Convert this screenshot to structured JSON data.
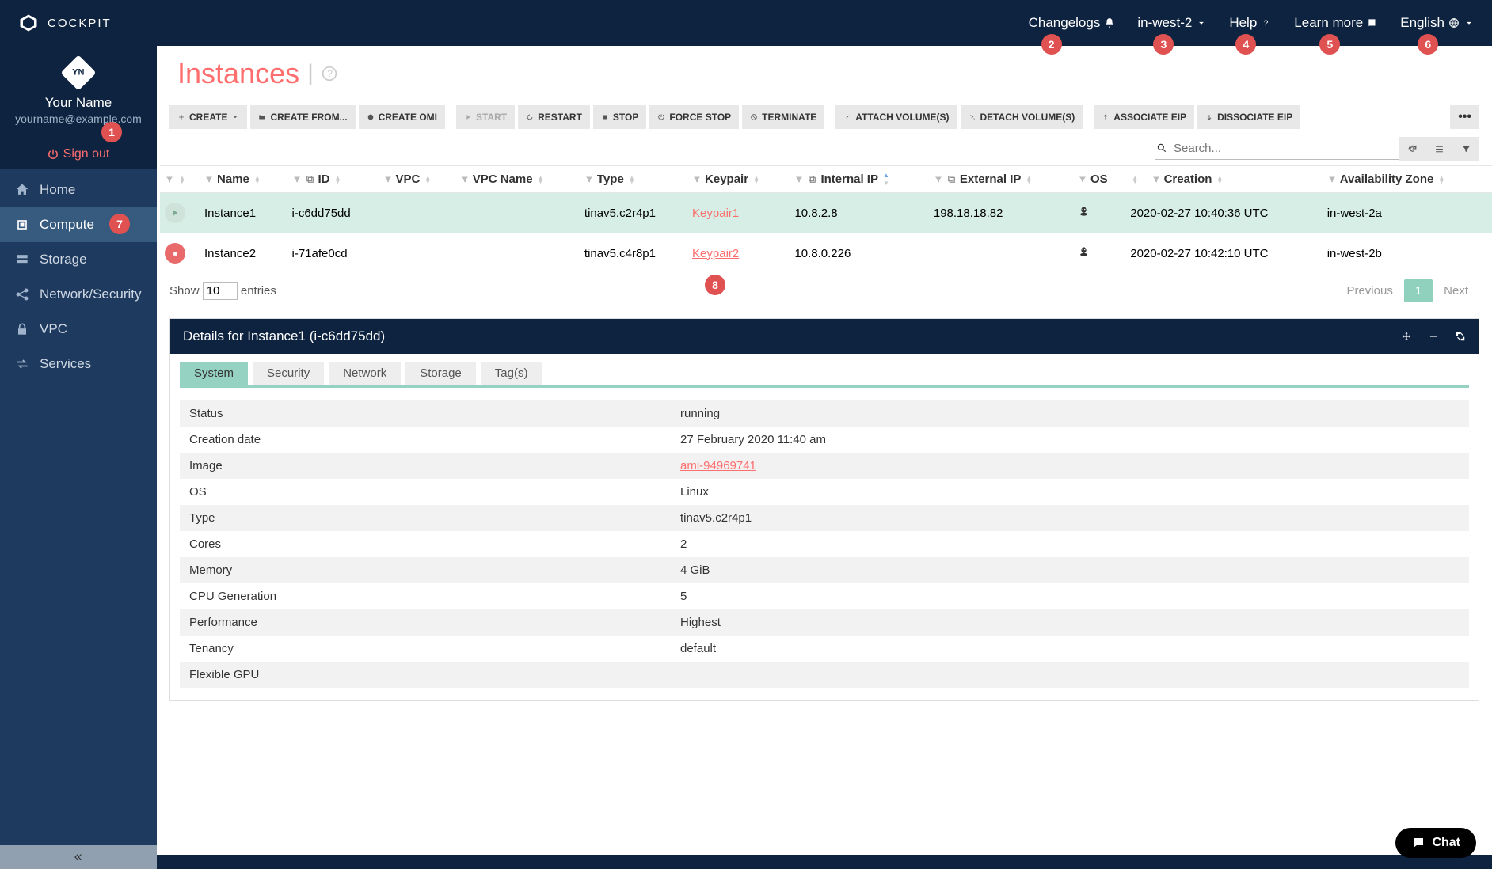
{
  "brand": "COCKPIT",
  "topnav": {
    "changelogs": "Changelogs",
    "region": "in-west-2",
    "help": "Help",
    "learnmore": "Learn more",
    "language": "English"
  },
  "callouts": {
    "c1": "1",
    "c2": "2",
    "c3": "3",
    "c4": "4",
    "c5": "5",
    "c6": "6",
    "c7": "7",
    "c8": "8"
  },
  "user": {
    "initials": "YN",
    "name": "Your Name",
    "email": "yourname@example.com",
    "signout": "Sign out"
  },
  "sidebar": {
    "items": [
      {
        "label": "Home"
      },
      {
        "label": "Compute"
      },
      {
        "label": "Storage"
      },
      {
        "label": "Network/Security"
      },
      {
        "label": "VPC"
      },
      {
        "label": "Services"
      }
    ]
  },
  "page": {
    "title": "Instances"
  },
  "toolbar": {
    "create": "CREATE",
    "createfrom": "CREATE FROM...",
    "createomi": "CREATE OMI",
    "start": "START",
    "restart": "RESTART",
    "stop": "STOP",
    "forcestop": "FORCE STOP",
    "terminate": "TERMINATE",
    "attach": "ATTACH VOLUME(S)",
    "detach": "DETACH VOLUME(S)",
    "assoc": "ASSOCIATE EIP",
    "dissoc": "DISSOCIATE EIP"
  },
  "search": {
    "placeholder": "Search..."
  },
  "columns": {
    "name": "Name",
    "id": "ID",
    "vpc": "VPC",
    "vpcname": "VPC Name",
    "type": "Type",
    "keypair": "Keypair",
    "intip": "Internal IP",
    "extip": "External IP",
    "os": "OS",
    "creation": "Creation",
    "az": "Availability Zone"
  },
  "rows": [
    {
      "state": "running",
      "name": "Instance1",
      "id": "i-c6dd75dd",
      "vpc": "",
      "vpcname": "",
      "type": "tinav5.c2r4p1",
      "keypair": "Keypair1",
      "intip": "10.8.2.8",
      "extip": "198.18.18.82",
      "os": "linux",
      "creation": "2020-02-27 10:40:36 UTC",
      "az": "in-west-2a"
    },
    {
      "state": "stopped",
      "name": "Instance2",
      "id": "i-71afe0cd",
      "vpc": "",
      "vpcname": "",
      "type": "tinav5.c4r8p1",
      "keypair": "Keypair2",
      "intip": "10.8.0.226",
      "extip": "",
      "os": "linux",
      "creation": "2020-02-27 10:42:10 UTC",
      "az": "in-west-2b"
    }
  ],
  "footer": {
    "showprefix": "Show",
    "showsuffix": "entries",
    "pagesize": "10",
    "previous": "Previous",
    "page": "1",
    "next": "Next"
  },
  "details": {
    "title": "Details for Instance1 (i-c6dd75dd)",
    "tabs": {
      "system": "System",
      "security": "Security",
      "network": "Network",
      "storage": "Storage",
      "tags": "Tag(s)"
    },
    "rows": [
      {
        "k": "Status",
        "v": "running"
      },
      {
        "k": "Creation date",
        "v": "27 February 2020 11:40 am"
      },
      {
        "k": "Image",
        "v": "ami-94969741",
        "link": true
      },
      {
        "k": "OS",
        "v": "Linux"
      },
      {
        "k": "Type",
        "v": "tinav5.c2r4p1"
      },
      {
        "k": "Cores",
        "v": "2"
      },
      {
        "k": "Memory",
        "v": "4 GiB"
      },
      {
        "k": "CPU Generation",
        "v": "5"
      },
      {
        "k": "Performance",
        "v": "Highest"
      },
      {
        "k": "Tenancy",
        "v": "default"
      },
      {
        "k": "Flexible GPU",
        "v": ""
      }
    ]
  },
  "chat": "Chat"
}
